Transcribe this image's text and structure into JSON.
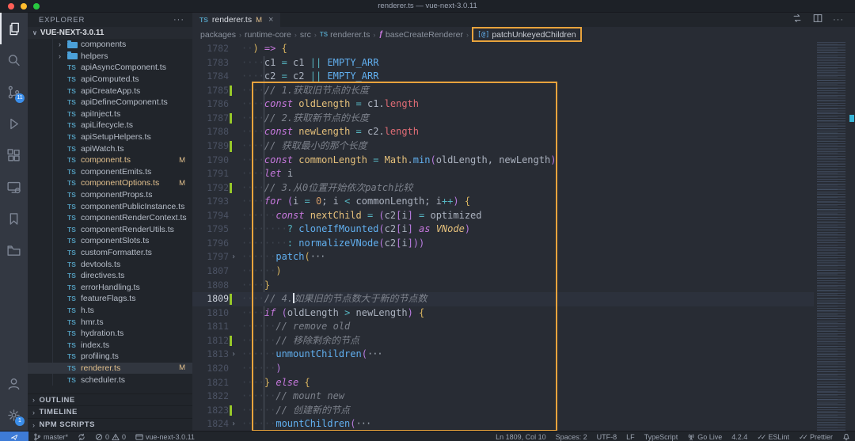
{
  "title_bar": {
    "title": "renderer.ts — vue-next-3.0.11"
  },
  "activity_bar": {
    "top": [
      {
        "name": "explorer",
        "active": true
      },
      {
        "name": "search"
      },
      {
        "name": "source-control",
        "badge": "11"
      },
      {
        "name": "run-debug"
      },
      {
        "name": "extensions"
      },
      {
        "name": "remote-explorer"
      },
      {
        "name": "bookmarks"
      },
      {
        "name": "project-manager"
      }
    ],
    "bottom": [
      {
        "name": "account"
      },
      {
        "name": "settings",
        "badge": "1"
      }
    ]
  },
  "sidebar": {
    "header": "EXPLORER",
    "project": "VUE-NEXT-3.0.11",
    "files": [
      {
        "type": "folder",
        "name": "components"
      },
      {
        "type": "folder",
        "name": "helpers"
      },
      {
        "type": "ts",
        "name": "apiAsyncComponent.ts"
      },
      {
        "type": "ts",
        "name": "apiComputed.ts"
      },
      {
        "type": "ts",
        "name": "apiCreateApp.ts"
      },
      {
        "type": "ts",
        "name": "apiDefineComponent.ts"
      },
      {
        "type": "ts",
        "name": "apiInject.ts"
      },
      {
        "type": "ts",
        "name": "apiLifecycle.ts"
      },
      {
        "type": "ts",
        "name": "apiSetupHelpers.ts"
      },
      {
        "type": "ts",
        "name": "apiWatch.ts"
      },
      {
        "type": "ts",
        "name": "component.ts",
        "badge": "M"
      },
      {
        "type": "ts",
        "name": "componentEmits.ts"
      },
      {
        "type": "ts",
        "name": "componentOptions.ts",
        "badge": "M"
      },
      {
        "type": "ts",
        "name": "componentProps.ts"
      },
      {
        "type": "ts",
        "name": "componentPublicInstance.ts"
      },
      {
        "type": "ts",
        "name": "componentRenderContext.ts"
      },
      {
        "type": "ts",
        "name": "componentRenderUtils.ts"
      },
      {
        "type": "ts",
        "name": "componentSlots.ts"
      },
      {
        "type": "ts",
        "name": "customFormatter.ts"
      },
      {
        "type": "ts",
        "name": "devtools.ts"
      },
      {
        "type": "ts",
        "name": "directives.ts"
      },
      {
        "type": "ts",
        "name": "errorHandling.ts"
      },
      {
        "type": "ts",
        "name": "featureFlags.ts"
      },
      {
        "type": "ts",
        "name": "h.ts"
      },
      {
        "type": "ts",
        "name": "hmr.ts"
      },
      {
        "type": "ts",
        "name": "hydration.ts"
      },
      {
        "type": "ts",
        "name": "index.ts"
      },
      {
        "type": "ts",
        "name": "profiling.ts"
      },
      {
        "type": "ts",
        "name": "renderer.ts",
        "badge": "M",
        "selected": true
      },
      {
        "type": "ts",
        "name": "scheduler.ts"
      }
    ],
    "bottom_sections": [
      "OUTLINE",
      "TIMELINE",
      "NPM SCRIPTS"
    ]
  },
  "editor": {
    "tab": {
      "type_label": "TS",
      "name": "renderer.ts",
      "modified": "M"
    },
    "breadcrumbs": [
      {
        "label": "packages"
      },
      {
        "label": "runtime-core"
      },
      {
        "label": "src"
      },
      {
        "label": "renderer.ts",
        "icon": "ts"
      },
      {
        "label": "baseCreateRenderer",
        "icon": "function"
      },
      {
        "label": "patchUnkeyedChildren",
        "icon": "method",
        "boxed": true
      }
    ],
    "code_lines": [
      {
        "n": 1782,
        "i": 2,
        "t": [
          [
            "b1",
            ") "
          ],
          [
            "kw",
            "=> "
          ],
          [
            "b1",
            "{"
          ]
        ]
      },
      {
        "n": 1783,
        "i": 4,
        "t": [
          [
            "var",
            "c1 "
          ],
          [
            "op",
            "= "
          ],
          [
            "var",
            "c1 "
          ],
          [
            "op",
            "|| "
          ],
          [
            "fn",
            "EMPTY_ARR"
          ]
        ]
      },
      {
        "n": 1784,
        "i": 4,
        "t": [
          [
            "var",
            "c2 "
          ],
          [
            "op",
            "= "
          ],
          [
            "var",
            "c2 "
          ],
          [
            "op",
            "|| "
          ],
          [
            "fn",
            "EMPTY_ARR"
          ]
        ]
      },
      {
        "n": 1785,
        "i": 4,
        "g": 1,
        "t": [
          [
            "cm",
            "// 1.获取旧节点的长度"
          ]
        ]
      },
      {
        "n": 1786,
        "i": 4,
        "t": [
          [
            "kw",
            "const "
          ],
          [
            "decl",
            "oldLength "
          ],
          [
            "op",
            "= "
          ],
          [
            "var",
            "c1"
          ],
          [
            "txt",
            "."
          ],
          [
            "prop",
            "length"
          ]
        ]
      },
      {
        "n": 1787,
        "i": 4,
        "g": 1,
        "t": [
          [
            "cm",
            "// 2.获取新节点的长度"
          ]
        ]
      },
      {
        "n": 1788,
        "i": 4,
        "t": [
          [
            "kw",
            "const "
          ],
          [
            "decl",
            "newLength "
          ],
          [
            "op",
            "= "
          ],
          [
            "var",
            "c2"
          ],
          [
            "txt",
            "."
          ],
          [
            "prop",
            "length"
          ]
        ]
      },
      {
        "n": 1789,
        "i": 4,
        "g": 1,
        "t": [
          [
            "cm",
            "// 获取最小的那个长度"
          ]
        ]
      },
      {
        "n": 1790,
        "i": 4,
        "t": [
          [
            "kw",
            "const "
          ],
          [
            "decl",
            "commonLength "
          ],
          [
            "op",
            "= "
          ],
          [
            "decl",
            "Math"
          ],
          [
            "txt",
            "."
          ],
          [
            "fn",
            "min"
          ],
          [
            "b2",
            "("
          ],
          [
            "var",
            "oldLength"
          ],
          [
            "txt",
            ", "
          ],
          [
            "var",
            "newLength"
          ],
          [
            "b2",
            ")"
          ]
        ]
      },
      {
        "n": 1791,
        "i": 4,
        "t": [
          [
            "kw",
            "let "
          ],
          [
            "var",
            "i"
          ]
        ]
      },
      {
        "n": 1792,
        "i": 4,
        "g": 1,
        "t": [
          [
            "cm",
            "// 3.从0位置开始依次patch比较"
          ]
        ]
      },
      {
        "n": 1793,
        "i": 4,
        "t": [
          [
            "kw",
            "for "
          ],
          [
            "b2",
            "("
          ],
          [
            "var",
            "i "
          ],
          [
            "op",
            "= "
          ],
          [
            "num",
            "0"
          ],
          [
            "txt",
            "; "
          ],
          [
            "var",
            "i "
          ],
          [
            "op",
            "< "
          ],
          [
            "var",
            "commonLength"
          ],
          [
            "txt",
            "; "
          ],
          [
            "var",
            "i"
          ],
          [
            "op",
            "++"
          ],
          [
            "b2",
            ") "
          ],
          [
            "b1",
            "{"
          ]
        ]
      },
      {
        "n": 1794,
        "i": 6,
        "t": [
          [
            "kw",
            "const "
          ],
          [
            "decl",
            "nextChild "
          ],
          [
            "op",
            "= "
          ],
          [
            "b2",
            "("
          ],
          [
            "var",
            "c2"
          ],
          [
            "b2",
            "["
          ],
          [
            "var",
            "i"
          ],
          [
            "b2",
            "] "
          ],
          [
            "op",
            "= "
          ],
          [
            "var",
            "optimized"
          ]
        ]
      },
      {
        "n": 1795,
        "i": 8,
        "t": [
          [
            "op",
            "? "
          ],
          [
            "fn",
            "cloneIfMounted"
          ],
          [
            "b2",
            "("
          ],
          [
            "var",
            "c2"
          ],
          [
            "b2",
            "["
          ],
          [
            "var",
            "i"
          ],
          [
            "b2",
            "] "
          ],
          [
            "kw",
            "as "
          ],
          [
            "type",
            "VNode"
          ],
          [
            "b2",
            ")"
          ]
        ]
      },
      {
        "n": 1796,
        "i": 8,
        "t": [
          [
            "op",
            ": "
          ],
          [
            "fn",
            "normalizeVNode"
          ],
          [
            "b2",
            "("
          ],
          [
            "var",
            "c2"
          ],
          [
            "b2",
            "["
          ],
          [
            "var",
            "i"
          ],
          [
            "b2",
            "]"
          ],
          [
            "b2",
            "))"
          ]
        ]
      },
      {
        "n": 1797,
        "i": 6,
        "f": 1,
        "t": [
          [
            "fn",
            "patch"
          ],
          [
            "b1",
            "("
          ],
          [
            "fold",
            "···"
          ]
        ]
      },
      {
        "n": 1807,
        "i": 6,
        "t": [
          [
            "b1",
            ")"
          ]
        ]
      },
      {
        "n": 1808,
        "i": 4,
        "t": [
          [
            "b1",
            "}"
          ]
        ]
      },
      {
        "n": 1809,
        "i": 4,
        "g": 1,
        "c": 1,
        "t": [
          [
            "cm",
            "// 4."
          ],
          [
            "cur",
            ""
          ],
          [
            "cm",
            "如果旧的节点数大于新的节点数"
          ]
        ]
      },
      {
        "n": 1810,
        "i": 4,
        "t": [
          [
            "kw",
            "if "
          ],
          [
            "b2",
            "("
          ],
          [
            "var",
            "oldLength "
          ],
          [
            "op",
            "> "
          ],
          [
            "var",
            "newLength"
          ],
          [
            "b2",
            ") "
          ],
          [
            "b1",
            "{"
          ]
        ]
      },
      {
        "n": 1811,
        "i": 6,
        "t": [
          [
            "cm",
            "// remove old"
          ]
        ]
      },
      {
        "n": 1812,
        "i": 6,
        "g": 1,
        "t": [
          [
            "cm",
            "// 移除剩余的节点"
          ]
        ]
      },
      {
        "n": 1813,
        "i": 6,
        "f": 1,
        "t": [
          [
            "fn",
            "unmountChildren"
          ],
          [
            "b2",
            "("
          ],
          [
            "fold",
            "···"
          ]
        ]
      },
      {
        "n": 1820,
        "i": 6,
        "t": [
          [
            "b2",
            ")"
          ]
        ]
      },
      {
        "n": 1821,
        "i": 4,
        "t": [
          [
            "b1",
            "} "
          ],
          [
            "kw",
            "else "
          ],
          [
            "b1",
            "{"
          ]
        ]
      },
      {
        "n": 1822,
        "i": 6,
        "t": [
          [
            "cm",
            "// mount new"
          ]
        ]
      },
      {
        "n": 1823,
        "i": 6,
        "g": 1,
        "t": [
          [
            "cm",
            "// 创建新的节点"
          ]
        ]
      },
      {
        "n": 1824,
        "i": 6,
        "f": 1,
        "t": [
          [
            "fn",
            "mountChildren"
          ],
          [
            "b2",
            "("
          ],
          [
            "fold",
            "···"
          ]
        ]
      }
    ]
  },
  "status_bar": {
    "left": [
      {
        "name": "remote-indicator",
        "icon": "remote",
        "label": ""
      },
      {
        "name": "git-branch",
        "icon": "branch",
        "label": "master*"
      },
      {
        "name": "sync",
        "icon": "sync",
        "label": ""
      },
      {
        "name": "problems",
        "icon": "problems",
        "errors": "0",
        "warnings": "0"
      },
      {
        "name": "workspace",
        "icon": "window",
        "label": "vue-next-3.0.11"
      }
    ],
    "right": [
      {
        "name": "cursor-position",
        "label": "Ln 1809, Col 10"
      },
      {
        "name": "indentation",
        "label": "Spaces: 2"
      },
      {
        "name": "encoding",
        "label": "UTF-8"
      },
      {
        "name": "eol",
        "label": "LF"
      },
      {
        "name": "language-mode",
        "label": "TypeScript"
      },
      {
        "name": "go-live",
        "icon": "broadcast",
        "label": "Go Live"
      },
      {
        "name": "version",
        "label": "4.2.4"
      },
      {
        "name": "eslint",
        "check": true,
        "label": "ESLint"
      },
      {
        "name": "prettier",
        "check": true,
        "label": "Prettier"
      },
      {
        "name": "notifications",
        "icon": "bell",
        "label": ""
      }
    ]
  },
  "annotations": {
    "box_color": "#e8a33d"
  }
}
